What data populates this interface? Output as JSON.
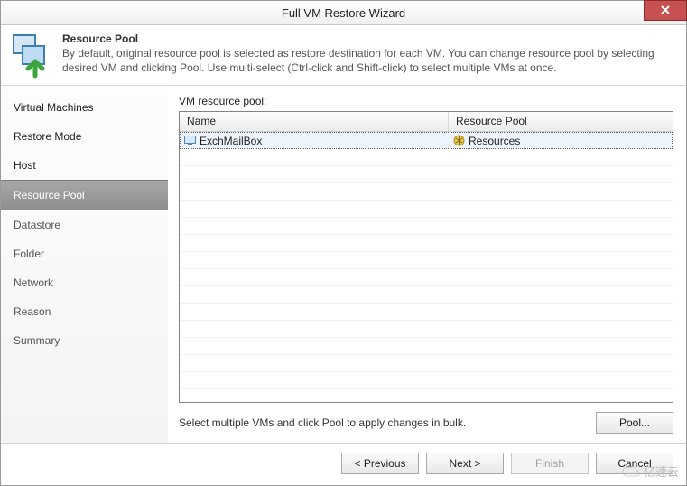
{
  "title": "Full VM Restore Wizard",
  "header": {
    "title": "Resource Pool",
    "description": "By default, original resource pool is selected as restore destination for each VM. You can change resource pool by selecting desired VM and clicking Pool. Use multi-select (Ctrl-click and Shift-click) to select multiple VMs at once."
  },
  "steps": [
    {
      "label": "Virtual Machines",
      "state": "visited"
    },
    {
      "label": "Restore Mode",
      "state": "visited"
    },
    {
      "label": "Host",
      "state": "visited"
    },
    {
      "label": "Resource Pool",
      "state": "current"
    },
    {
      "label": "Datastore",
      "state": "todo"
    },
    {
      "label": "Folder",
      "state": "todo"
    },
    {
      "label": "Network",
      "state": "todo"
    },
    {
      "label": "Reason",
      "state": "todo"
    },
    {
      "label": "Summary",
      "state": "todo"
    }
  ],
  "tableLabel": "VM resource pool:",
  "columns": {
    "name": "Name",
    "pool": "Resource Pool"
  },
  "rows": [
    {
      "name": "ExchMailBox",
      "pool": "Resources",
      "selected": true
    }
  ],
  "emptyRowCount": 15,
  "hint": "Select multiple VMs and click Pool to apply changes in bulk.",
  "buttons": {
    "pool": "Pool...",
    "previous": "< Previous",
    "next": "Next >",
    "finish": "Finish",
    "cancel": "Cancel"
  },
  "watermark": "亿速云"
}
